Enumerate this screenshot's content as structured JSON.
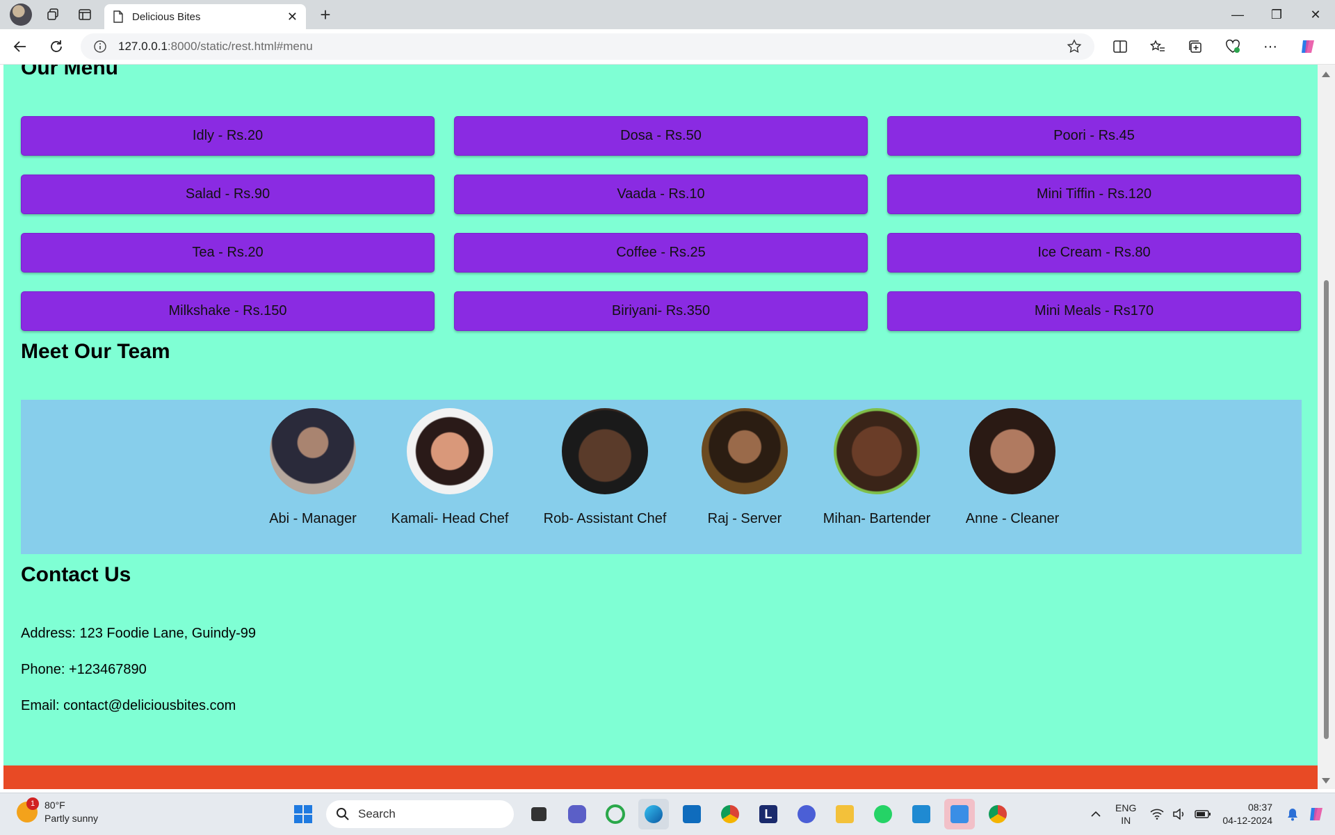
{
  "browser": {
    "tab_title": "Delicious Bites",
    "url_host": "127.0.0.1",
    "url_path": ":8000/static/rest.html#menu"
  },
  "page": {
    "menu_title": "Our Menu",
    "menu_items": [
      "Idly - Rs.20",
      "Dosa - Rs.50",
      "Poori - Rs.45",
      "Salad - Rs.90",
      "Vaada - Rs.10",
      "Mini Tiffin - Rs.120",
      "Tea - Rs.20",
      "Coffee - Rs.25",
      "Ice Cream - Rs.80",
      "Milkshake - Rs.150",
      "Biriyani- Rs.350",
      "Mini Meals - Rs170"
    ],
    "team_title": "Meet Our Team",
    "team": [
      {
        "role": "Abi - Manager",
        "photo_color": "#6b5a5a"
      },
      {
        "role": "Kamali- Head Chef",
        "photo_color": "#c88a6a"
      },
      {
        "role": "Rob- Assistant Chef",
        "photo_color": "#3b2a22"
      },
      {
        "role": "Raj - Server",
        "photo_color": "#5a3a1e"
      },
      {
        "role": "Mihan- Bartender",
        "photo_color": "#4a2d1f"
      },
      {
        "role": "Anne - Cleaner",
        "photo_color": "#8a5a45"
      }
    ],
    "contact_title": "Contact Us",
    "address": "Address: 123 Foodie Lane, Guindy-99",
    "phone": "Phone: +123467890",
    "email": "Email: contact@deliciousbites.com"
  },
  "colors": {
    "page_bg": "#7fffd4",
    "menu_button": "#8a2be2",
    "team_bg": "#87ceeb",
    "footer": "#e84a25"
  },
  "taskbar": {
    "weather_temp": "80°F",
    "weather_desc": "Partly sunny",
    "weather_badge": "1",
    "search_placeholder": "Search",
    "lang_line1": "ENG",
    "lang_line2": "IN",
    "time": "08:37",
    "date": "04-12-2024"
  }
}
